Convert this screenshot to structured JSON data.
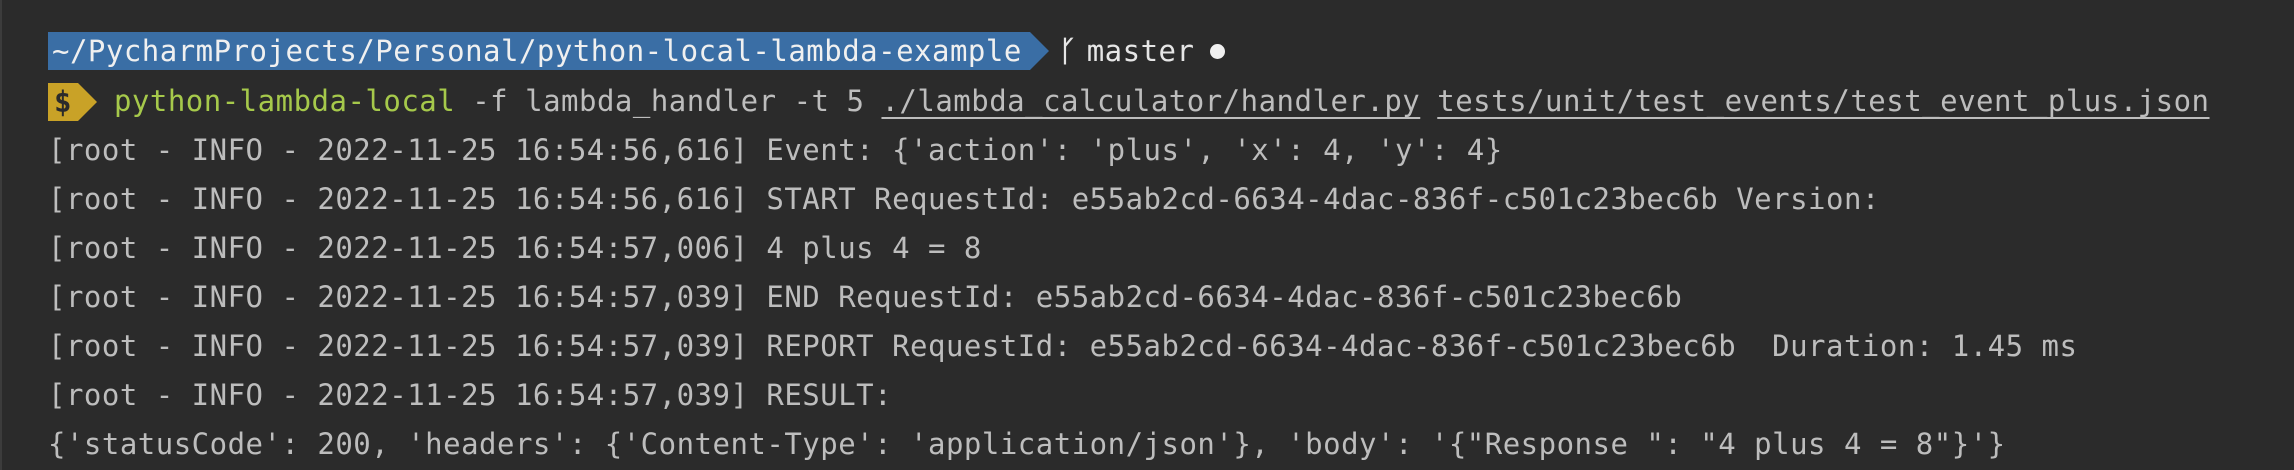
{
  "colors": {
    "background": "#2b2b2b",
    "path_segment_bg": "#3a6ea5",
    "path_segment_fg": "#f0f0f0",
    "branch_segment_bg": "#2b2b2b",
    "prompt_symbol_bg": "#c9a227",
    "prompt_symbol_fg": "#2b2b2b",
    "command_green": "#a6c94b",
    "output_text": "#bdbdbd",
    "dot_color": "#f0f0f0"
  },
  "prompt": {
    "path": "~/PycharmProjects/Personal/python-local-lambda-example",
    "branch_icon": "git-branch-icon",
    "branch_glyph": "ᚴ",
    "branch_name": "master",
    "dirty_indicator": "●",
    "symbol": "$"
  },
  "command": {
    "binary": "python-lambda-local",
    "arg_flag_f": "-f",
    "arg_function": "lambda_handler",
    "arg_flag_t": "-t",
    "arg_timeout": "5",
    "arg_file": "./lambda_calculator/handler.py",
    "arg_event": "tests/unit/test_events/test_event_plus.json"
  },
  "output_lines": [
    "[root - INFO - 2022-11-25 16:54:56,616] Event: {'action': 'plus', 'x': 4, 'y': 4}",
    "[root - INFO - 2022-11-25 16:54:56,616] START RequestId: e55ab2cd-6634-4dac-836f-c501c23bec6b Version:",
    "[root - INFO - 2022-11-25 16:54:57,006] 4 plus 4 = 8",
    "[root - INFO - 2022-11-25 16:54:57,039] END RequestId: e55ab2cd-6634-4dac-836f-c501c23bec6b",
    "[root - INFO - 2022-11-25 16:54:57,039] REPORT RequestId: e55ab2cd-6634-4dac-836f-c501c23bec6b  Duration: 1.45 ms",
    "[root - INFO - 2022-11-25 16:54:57,039] RESULT:",
    "{'statusCode': 200, 'headers': {'Content-Type': 'application/json'}, 'body': '{\"Response \": \"4 plus 4 = 8\"}'}"
  ]
}
